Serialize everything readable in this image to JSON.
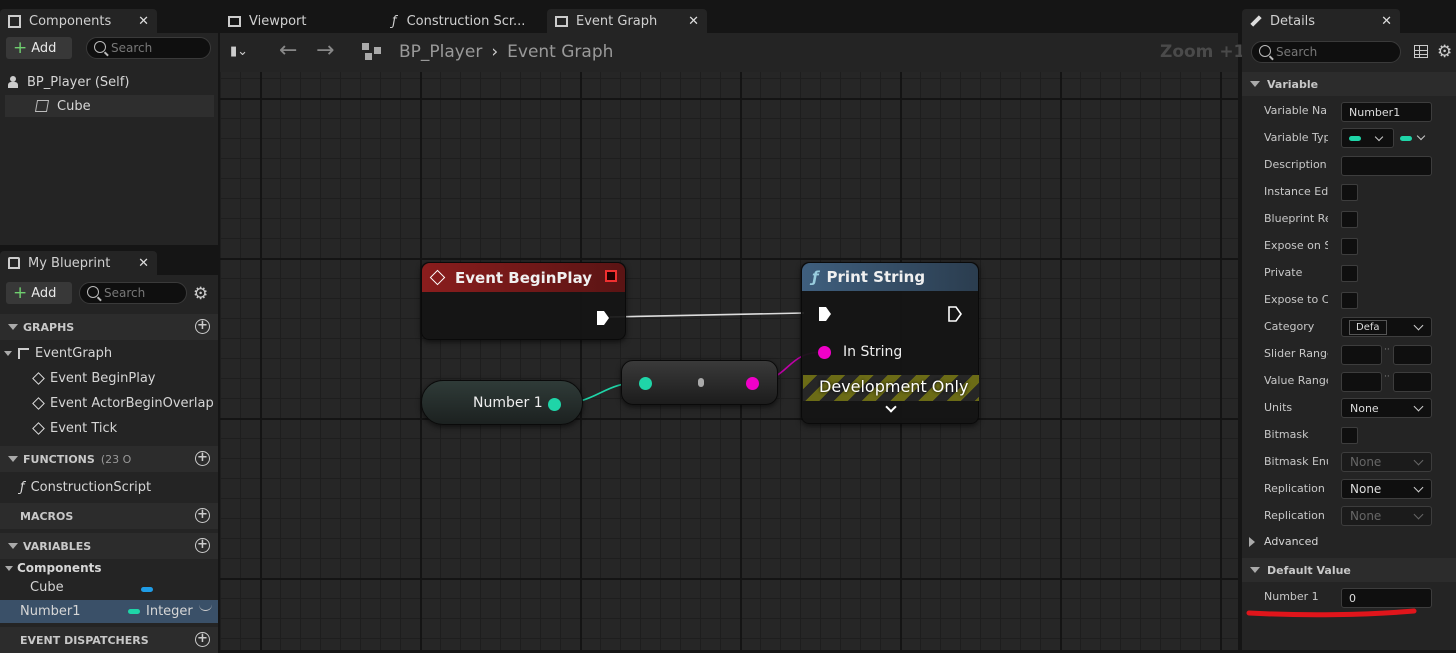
{
  "tabs": {
    "components": "Components",
    "viewport": "Viewport",
    "construction": "Construction Scr...",
    "event_graph": "Event Graph",
    "details": "Details"
  },
  "components_panel": {
    "add_label": "Add",
    "search_placeholder": "Search",
    "items": [
      "BP_Player (Self)",
      "Cube"
    ]
  },
  "my_blueprint": {
    "title": "My Blueprint",
    "add_label": "Add",
    "search_placeholder": "Search",
    "graphs_header": "GRAPHS",
    "event_graph": "EventGraph",
    "events": [
      "Event BeginPlay",
      "Event ActorBeginOverlap",
      "Event Tick"
    ],
    "functions_header": "FUNCTIONS",
    "functions_count": "(23 O",
    "functions": [
      "ConstructionScript"
    ],
    "macros_header": "MACROS",
    "variables_header": "VARIABLES",
    "components_group": "Components",
    "var_cube": "Cube",
    "var_number1": "Number1",
    "var_number1_type": "Integer",
    "dispatchers_header": "EVENT DISPATCHERS"
  },
  "graph_toolbar": {
    "breadcrumb_root": "BP_Player",
    "breadcrumb_current": "Event Graph",
    "zoom": "Zoom +1"
  },
  "nodes": {
    "begin_play": "Event BeginPlay",
    "number1": "Number 1",
    "print_string": "Print String",
    "in_string": "In String",
    "dev_only": "Development Only"
  },
  "details": {
    "search_placeholder": "Search",
    "variable_header": "Variable",
    "labels": {
      "var_name": "Variable Name",
      "var_type": "Variable Type",
      "description": "Description",
      "instance_edit": "Instance Editable",
      "bp_readonly": "Blueprint Read Only",
      "expose_spawn": "Expose on Spawn",
      "private": "Private",
      "expose_cine": "Expose to Cinematics",
      "category": "Category",
      "slider_range": "Slider Range",
      "value_range": "Value Range",
      "units": "Units",
      "bitmask": "Bitmask",
      "bitmask_enum": "Bitmask Enum",
      "replication": "Replication",
      "replication_cond": "Replication Condition"
    },
    "values": {
      "var_name": "Number1",
      "category": "Defa",
      "units": "None",
      "bitmask_enum": "None",
      "replication": "None",
      "replication_cond": "None"
    },
    "advanced": "Advanced",
    "default_value_header": "Default Value",
    "default_label": "Number 1",
    "default_value": "0"
  },
  "colors": {
    "integer_pin": "#1fd5a8",
    "string_pin": "#f000c8",
    "event_head": "#8a1d1d",
    "function_head": "#3f5f7e",
    "annotation": "#e0151b"
  }
}
